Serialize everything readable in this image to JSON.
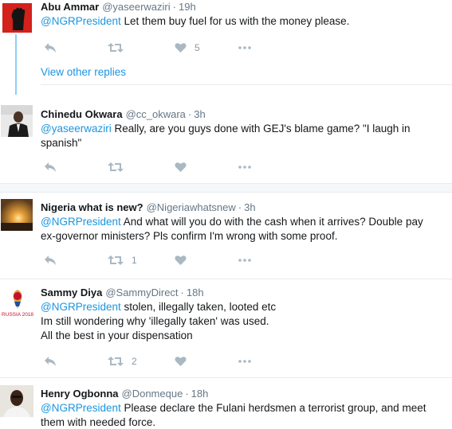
{
  "tweets": [
    {
      "name": "Abu Ammar",
      "handle": "@yaseerwaziri",
      "time": "19h",
      "lines": [
        {
          "mention": "@NGRPresident",
          "text": " Let them buy fuel for us with the money please."
        }
      ],
      "likes": "5",
      "retweets": ""
    },
    {
      "name": "Chinedu Okwara",
      "handle": "@cc_okwara",
      "time": "3h",
      "lines": [
        {
          "mention": "@yaseerwaziri",
          "text": " Really, are you guys done with GEJ's blame game? \"I laugh in"
        },
        {
          "mention": "",
          "text": "spanish\""
        }
      ],
      "likes": "",
      "retweets": ""
    },
    {
      "name": "Nigeria what is new?",
      "handle": "@Nigeriawhatsnew",
      "time": "3h",
      "lines": [
        {
          "mention": "@NGRPresident",
          "text": " And what will you do with the cash when it arrives? Double pay"
        },
        {
          "mention": "",
          "text": "ex-governor ministers? Pls confirm I'm wrong with some proof."
        }
      ],
      "likes": "",
      "retweets": "1"
    },
    {
      "name": "Sammy Diya",
      "handle": "@SammyDirect",
      "time": "18h",
      "lines": [
        {
          "mention": "@NGRPresident",
          "text": " stolen, illegally taken, looted etc"
        },
        {
          "mention": "",
          "text": "Im still wondering why 'illegally taken' was used."
        },
        {
          "mention": "",
          "text": "All the best in your dispensation"
        }
      ],
      "likes": "",
      "retweets": "2"
    },
    {
      "name": "Henry Ogbonna",
      "handle": "@Donmeque",
      "time": "18h",
      "lines": [
        {
          "mention": "@NGRPresident",
          "text": " Please declare the Fulani herdsmen a terrorist group, and meet"
        },
        {
          "mention": "",
          "text": "them with needed force."
        }
      ],
      "likes": "",
      "retweets": ""
    }
  ],
  "thread": {
    "view_replies": "View other replies"
  },
  "avatar_texts": {
    "sammy_badge": "RUSSIA 2018"
  },
  "colors": {
    "link": "#1b95e0",
    "icon": "#aab8c2",
    "thread_line": "#8ed0f3"
  },
  "icons": [
    "reply-icon",
    "retweet-icon",
    "heart-icon",
    "more-icon"
  ]
}
